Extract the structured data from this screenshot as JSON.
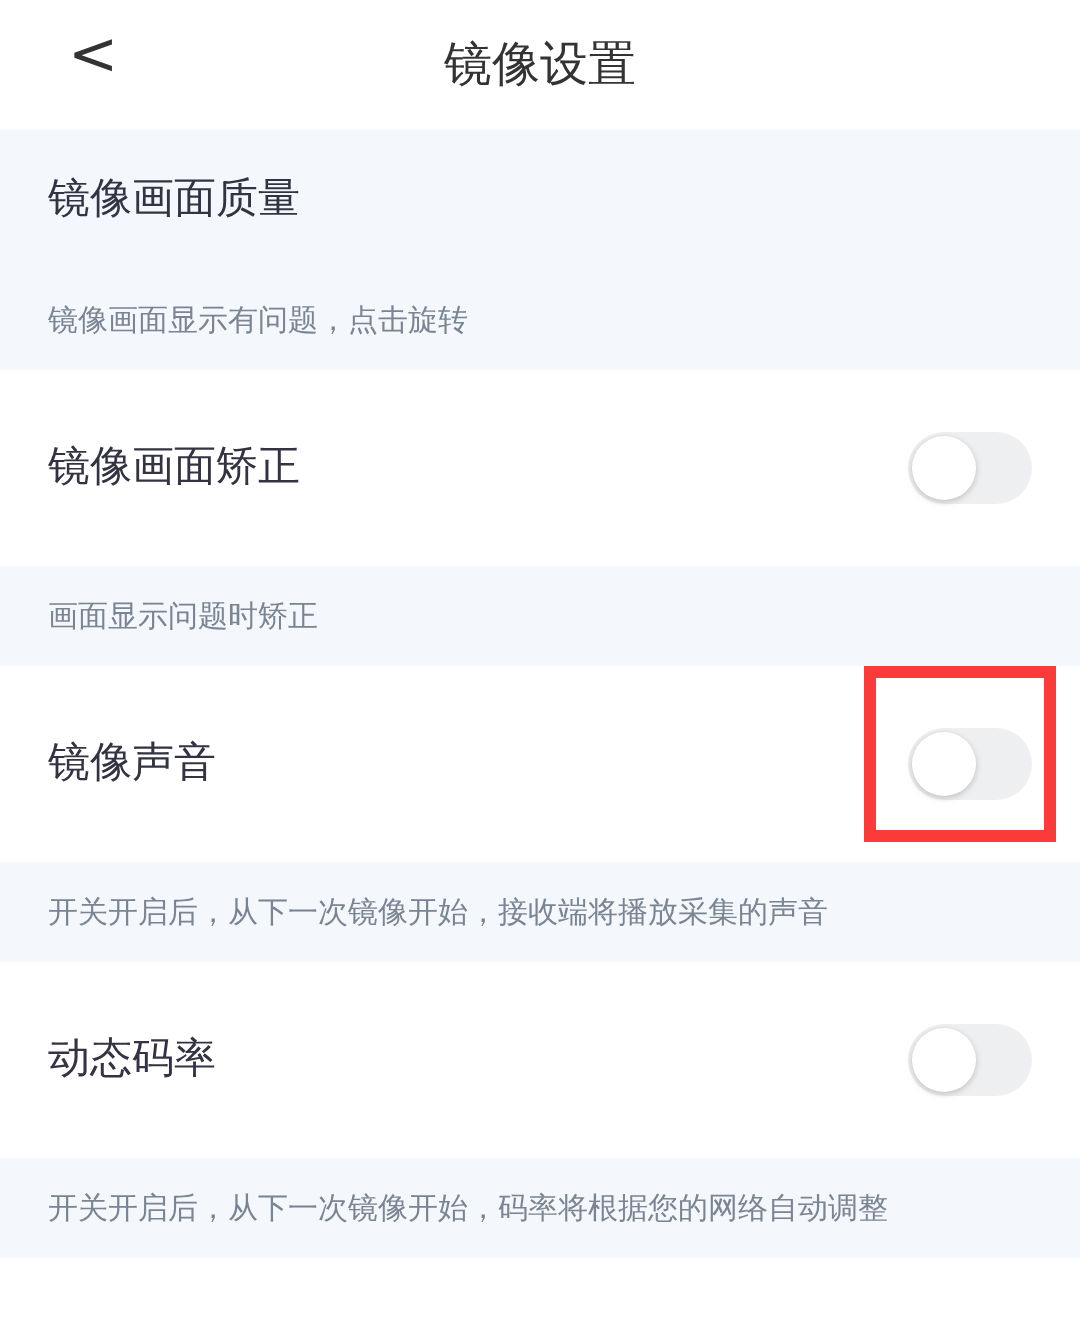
{
  "header": {
    "back": "<",
    "title": "镜像设置"
  },
  "items": [
    {
      "kind": "link",
      "label": "镜像画面质量"
    },
    {
      "kind": "hint",
      "text": "镜像画面显示有问题，点击旋转"
    },
    {
      "kind": "toggle",
      "label": "镜像画面矫正",
      "on": false,
      "highlighted": false
    },
    {
      "kind": "hint",
      "text": "画面显示问题时矫正"
    },
    {
      "kind": "toggle",
      "label": "镜像声音",
      "on": false,
      "highlighted": true
    },
    {
      "kind": "hint",
      "text": "开关开启后，从下一次镜像开始，接收端将播放采集的声音"
    },
    {
      "kind": "toggle",
      "label": "动态码率",
      "on": false,
      "highlighted": false
    },
    {
      "kind": "hint",
      "text": "开关开启后，从下一次镜像开始，码率将根据您的网络自动调整"
    }
  ]
}
